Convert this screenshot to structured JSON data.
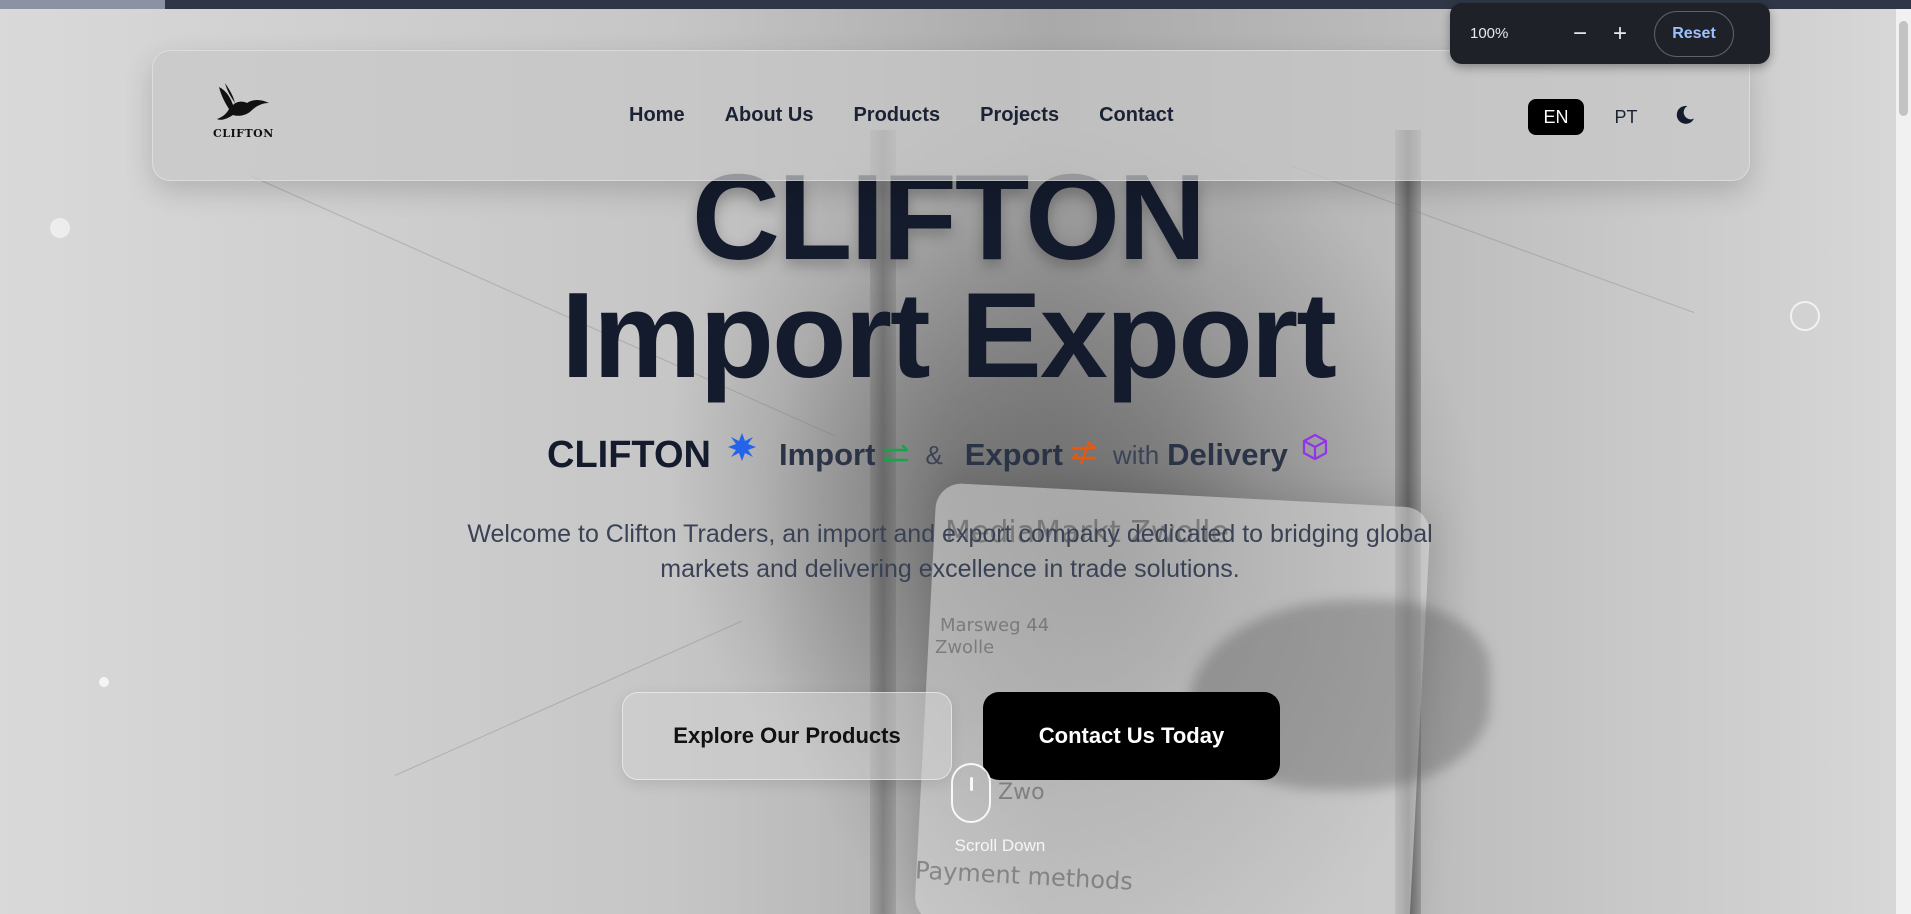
{
  "zoom": {
    "level": "100%",
    "minus": "−",
    "plus": "+",
    "reset": "Reset"
  },
  "nav": {
    "logo_text": "CLIFTON",
    "links": [
      "Home",
      "About Us",
      "Products",
      "Projects",
      "Contact"
    ],
    "lang_active": "EN",
    "lang_other": "PT",
    "theme_icon": "moon-icon"
  },
  "hero": {
    "title_line1": "CLIFTON",
    "title_line2": "Import Export",
    "tagline": {
      "brand": "CLIFTON",
      "import": "Import",
      "amp": "&",
      "export": "Export",
      "with": "with",
      "delivery": "Delivery"
    },
    "welcome": "Welcome to Clifton Traders, an import and export company dedicated to bridging global markets and delivering excellence in trade solutions.",
    "explore_button": "Explore Our Products",
    "contact_button": "Contact Us Today",
    "scroll_label": "Scroll Down"
  },
  "background_text": {
    "store": "MediaMarkt Zwolle",
    "address": "Marsweg 44",
    "city": "Zwolle",
    "short": "Zwo",
    "payment": "Payment methods"
  },
  "colors": {
    "burst": "#2563eb",
    "import_arrows": "#16a34a",
    "export_arrows": "#ea580c",
    "box": "#9333ea",
    "dark_text": "#141b2c"
  }
}
